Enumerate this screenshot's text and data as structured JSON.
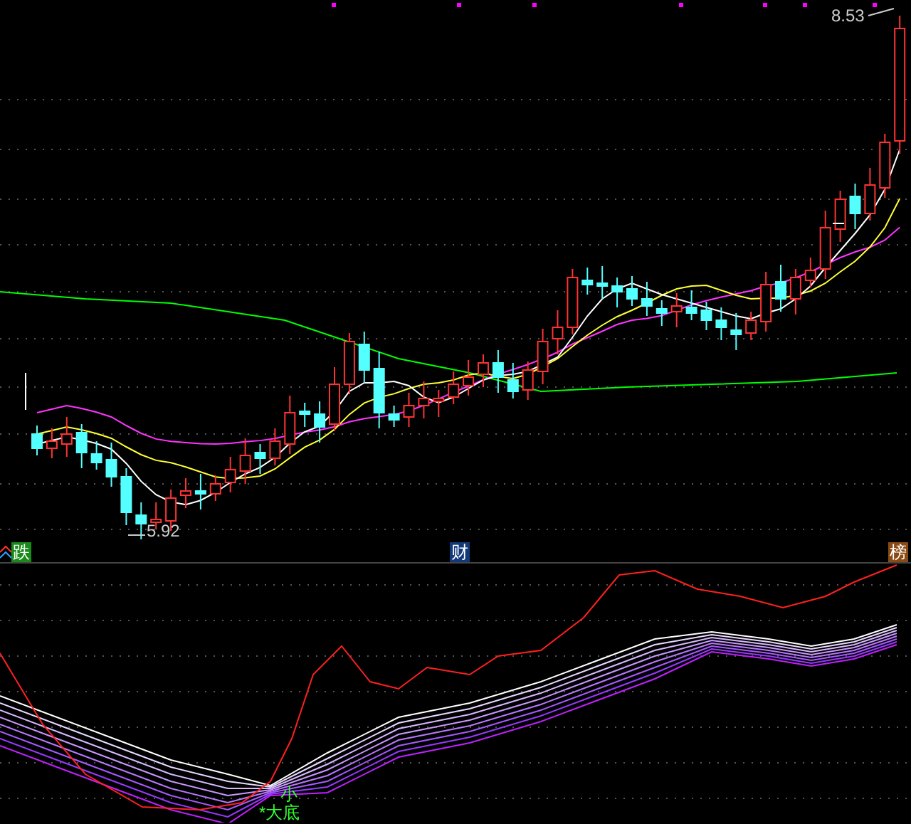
{
  "main_chart": {
    "high_label": "8.53",
    "low_label": "5.92"
  },
  "markers": [
    {
      "text": "跌",
      "color": "#1a8a1a"
    },
    {
      "text": "财",
      "color": "#123a7a"
    },
    {
      "text": "榜",
      "color": "#8a4a14"
    }
  ],
  "indicator": {
    "signals": [
      {
        "text": "小"
      },
      {
        "text": "*大底"
      }
    ]
  }
}
